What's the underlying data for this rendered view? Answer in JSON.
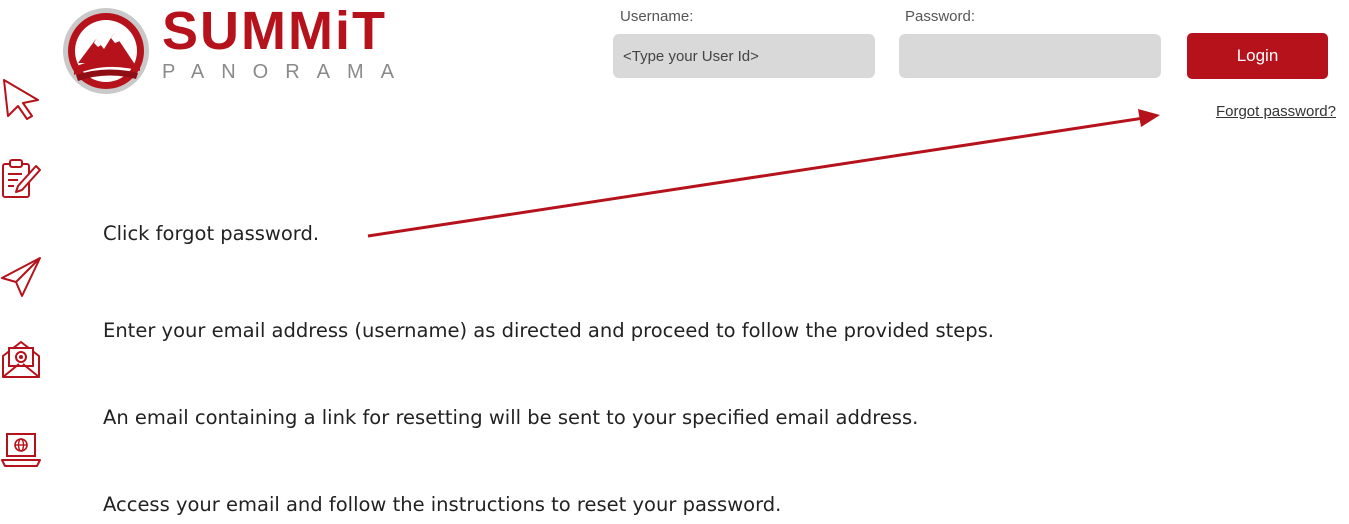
{
  "brand": {
    "name": "SUMMiT",
    "tagline": "PANORAMA",
    "primary_color": "#b5121b"
  },
  "login": {
    "username_label": "Username:",
    "username_placeholder": "<Type your User Id>",
    "password_label": "Password:",
    "password_value": "",
    "login_label": "Login",
    "forgot_label": "Forgot password?"
  },
  "icons": [
    "cursor-arrow-icon",
    "clipboard-edit-icon",
    "paper-plane-icon",
    "email-open-icon",
    "laptop-globe-icon"
  ],
  "steps": [
    "Click forgot password.",
    "Enter your email address (username) as directed and proceed to follow the provided steps.",
    "An email containing a link for resetting will be sent to your specified email address.",
    "Access your email and follow the instructions to reset your password."
  ]
}
